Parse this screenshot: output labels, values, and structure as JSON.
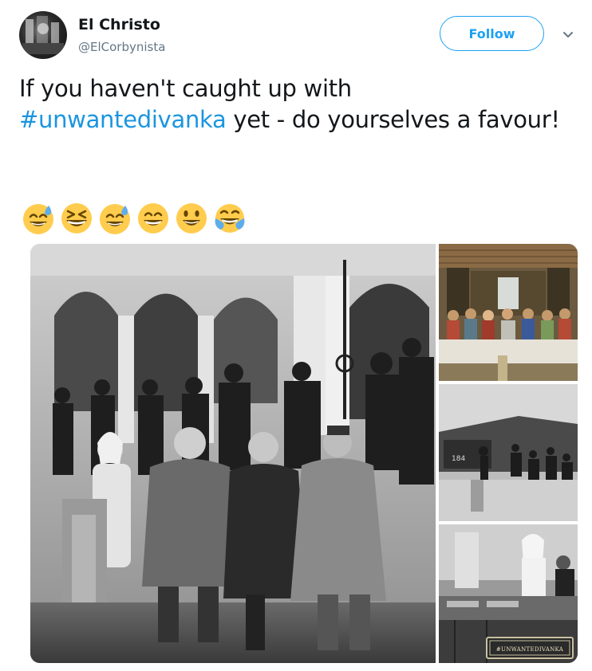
{
  "tweet": {
    "display_name": "El Christo",
    "handle": "@ElCorbynista",
    "follow_label": "Follow",
    "text_before": "If you haven't caught up with ",
    "hashtag": "#unwantedivanka",
    "text_after": " yet - do yourselves a favour!"
  },
  "emojis": [
    "sweat-smile-icon",
    "laughing-icon",
    "sweat-smile-icon",
    "grin-icon",
    "smiley-icon",
    "joy-icon"
  ],
  "media": {
    "watermark": "#UNWANTEDIVANKA"
  },
  "colors": {
    "accent": "#1da1f2",
    "hashtag": "#1b95e0",
    "handle": "#657786"
  }
}
